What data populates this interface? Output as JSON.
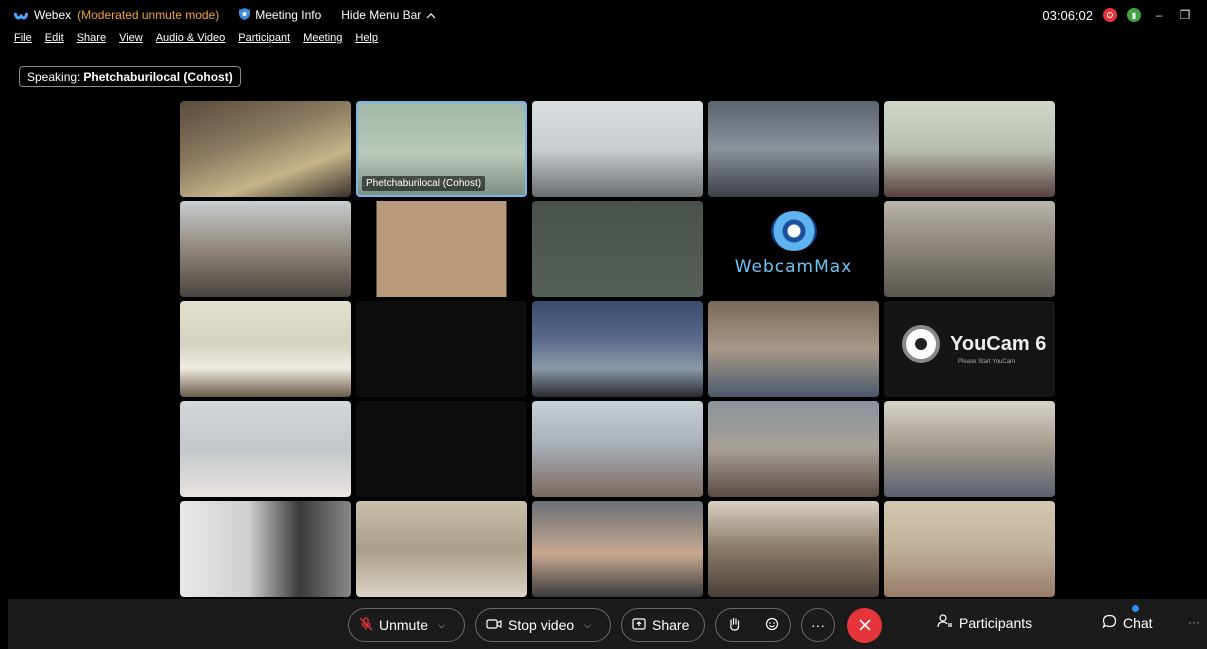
{
  "titlebar": {
    "app_name": "Webex",
    "mode": "(Moderated unmute mode)",
    "meeting_info": "Meeting Info",
    "hide_menu": "Hide Menu Bar",
    "time": "03:06:02",
    "minimize": "–",
    "restore": "❐"
  },
  "menu": [
    "File",
    "Edit",
    "Share",
    "View",
    "Audio & Video",
    "Participant",
    "Meeting",
    "Help"
  ],
  "speaking": {
    "prefix": "Speaking:",
    "name": "Phetchaburilocal (Cohost)"
  },
  "tiles": [
    {
      "bg": "linear-gradient(160deg,#5a4a3a 0%,#8a7a60 40%,#c7b48a 70%,#3a3028 100%)"
    },
    {
      "bg": "linear-gradient(180deg,#9fb8a8 0%,#b9c9bb 55%,#7e8f84 100%)",
      "active": true,
      "label": "Phetchaburilocal (Cohost)"
    },
    {
      "bg": "linear-gradient(180deg,#d8dde0 0%,#c8ced2 50%,#6a6e70 100%)"
    },
    {
      "bg": "linear-gradient(180deg,#5c6470 0%,#8a929a 50%,#3c4046 100%)"
    },
    {
      "bg": "linear-gradient(180deg,#cfd8c8 0%,#b8c0b0 50%,#5a4040 100%)"
    },
    {
      "bg": "linear-gradient(180deg,#c8cdd0 0%,#8a8074 55%,#4a4440 100%)"
    },
    {
      "bg": "linear-gradient(90deg,#000 0 12%,#b89a7a 12% 88%,#000 88%)"
    },
    {
      "bg": "linear-gradient(180deg,#4a524c 0%,#565e58 100%)"
    },
    {
      "bg": "#000",
      "webcammax": true
    },
    {
      "bg": "linear-gradient(180deg,#b7b4a8 0%,#8a8478 50%,#5a5650 100%)"
    },
    {
      "bg": "linear-gradient(180deg,#e4e0d0 0%,#d6d2c2 45%,#f0ece0 70%,#6a5a4a 100%)"
    },
    {
      "bg": "#0d0d0d"
    },
    {
      "bg": "linear-gradient(180deg,#3a4a6a 0%,#5a6a8a 40%,#8a9aaa 70%,#2a2a30 100%)"
    },
    {
      "bg": "linear-gradient(180deg,#7a6a5a 0%,#a89888 50%,#4a5a6a 100%)"
    },
    {
      "bg": "#151515",
      "youcam": true
    },
    {
      "bg": "linear-gradient(180deg,#d4d8dc 0%,#c4c8cc 50%,#e8e4e0 100%)"
    },
    {
      "bg": "#0d0d0d"
    },
    {
      "bg": "linear-gradient(180deg,#c8d0d8 0%,#a8b0b8 45%,#7a6a60 100%)"
    },
    {
      "bg": "linear-gradient(180deg,#8a949c 0%,#a8a098 50%,#5a4a44 100%)"
    },
    {
      "bg": "linear-gradient(180deg,#d8d4c8 0%,#a0988a 50%,#5a6070 100%)"
    },
    {
      "bg": "linear-gradient(90deg,#e8e8e8 0%,#d0d0d0 40%,#3a3a3a 70%,#888 100%)"
    },
    {
      "bg": "linear-gradient(180deg,#c8c0a8 0%,#a8a088 50%,#dcd4c4 100%)"
    },
    {
      "bg": "linear-gradient(180deg,#6a7078 0%,#c8a890 55%,#3a3a3a 100%)"
    },
    {
      "bg": "linear-gradient(180deg,#d8d0c0 0%,#8a7a68 50%,#4a4038 100%)"
    },
    {
      "bg": "linear-gradient(180deg,#d4c8b0 0%,#c0b09a 50%,#9a7a6a 100%)"
    }
  ],
  "tile_labels": {
    "cohost": "Phetchaburilocal (Cohost)",
    "webcammax": "WebcamMax",
    "youcam": "YouCam 6",
    "youcam_sub": "Please Start YouCam"
  },
  "controls": {
    "unmute": "Unmute",
    "stop_video": "Stop video",
    "share": "Share",
    "more": "···",
    "participants": "Participants",
    "chat": "Chat",
    "more_right": "···"
  }
}
